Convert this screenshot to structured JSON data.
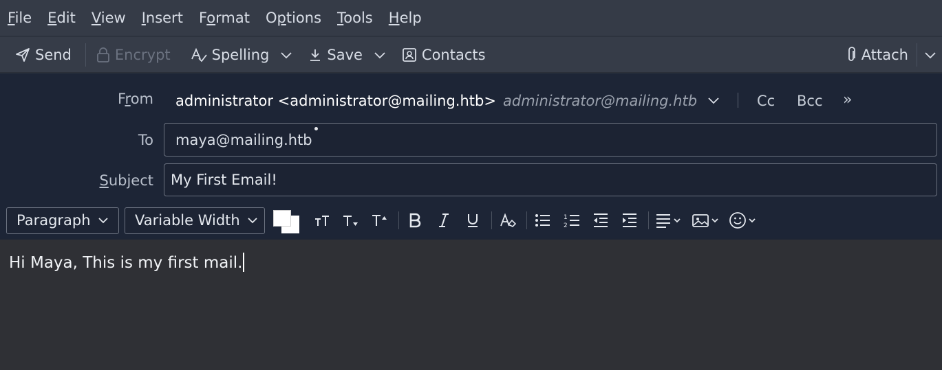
{
  "menubar": {
    "items": [
      {
        "accel": "F",
        "rest": "ile"
      },
      {
        "accel": "E",
        "rest": "dit"
      },
      {
        "accel": "V",
        "rest": "iew"
      },
      {
        "accel": "I",
        "rest": "nsert"
      },
      {
        "accel": "o",
        "pre": "F",
        "rest": "rmat"
      },
      {
        "accel": "p",
        "pre": "O",
        "rest": "tions"
      },
      {
        "accel": "T",
        "rest": "ools"
      },
      {
        "accel": "H",
        "rest": "elp"
      }
    ]
  },
  "toolbar": {
    "send_label": "Send",
    "encrypt_label": "Encrypt",
    "spelling_label": "Spelling",
    "save_label": "Save",
    "contacts_label": "Contacts",
    "attach_label": "Attach"
  },
  "header": {
    "from_label_pre": "F",
    "from_label_accel": "r",
    "from_label_post": "om",
    "from_value": "administrator <administrator@mailing.htb>",
    "from_alt": "administrator@mailing.htb",
    "cc_label": "Cc",
    "bcc_label": "Bcc",
    "more_label": "»",
    "to_label": "To",
    "to_recipient": "maya@mailing.htb",
    "subject_label_accel": "S",
    "subject_label_rest": "ubject",
    "subject_value": "My First Email!"
  },
  "formatbar": {
    "paragraph_format": "Paragraph",
    "font_family": "Variable Width",
    "text_color": "#ffffff",
    "background_color": "#ffffff"
  },
  "editor": {
    "body_text": "Hi Maya, This is my first mail."
  }
}
